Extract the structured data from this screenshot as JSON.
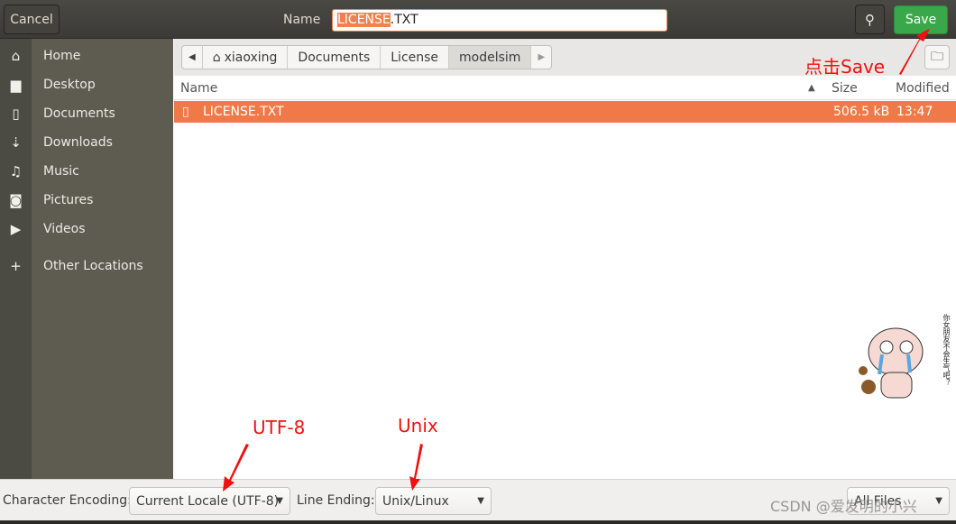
{
  "header": {
    "cancel": "Cancel",
    "name_label": "Name",
    "filename_selected": "LICENSE",
    "filename_rest": ".TXT",
    "save": "Save",
    "search_icon": "search-icon"
  },
  "sidebar": {
    "items": [
      {
        "label": "Home",
        "icon": "home-icon"
      },
      {
        "label": "Desktop",
        "icon": "folder-icon"
      },
      {
        "label": "Documents",
        "icon": "document-icon"
      },
      {
        "label": "Downloads",
        "icon": "download-icon"
      },
      {
        "label": "Music",
        "icon": "music-icon"
      },
      {
        "label": "Pictures",
        "icon": "camera-icon"
      },
      {
        "label": "Videos",
        "icon": "video-icon"
      },
      {
        "label": "Other Locations",
        "icon": "plus-icon"
      }
    ]
  },
  "pathbar": [
    "xiaoxing",
    "Documents",
    "License",
    "modelsim"
  ],
  "columns": {
    "name": "Name",
    "size": "Size",
    "modified": "Modified"
  },
  "files": [
    {
      "name": "LICENSE.TXT",
      "size": "506.5 kB",
      "modified": "13:47"
    }
  ],
  "bottom": {
    "encoding_label": "Character Encoding:",
    "encoding_value": "Current Locale (UTF-8)",
    "line_ending_label": "Line Ending:",
    "line_ending_value": "Unix/Linux",
    "filter_value": "All Files"
  },
  "annotations": {
    "save": "点击Save",
    "utf8": "UTF-8",
    "unix": "Unix",
    "color": "#f01010"
  },
  "watermark": "CSDN @爱发明的小兴",
  "sticker_text": "你女朋友不会生气吧？",
  "colors": {
    "selection": "#ef7a48",
    "save": "#3aa84a",
    "sidebar": "#5e5c50"
  }
}
